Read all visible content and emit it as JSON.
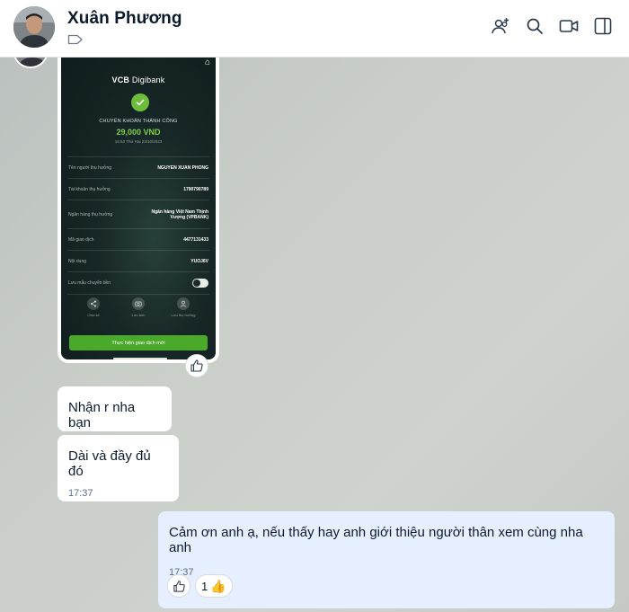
{
  "header": {
    "contact_name": "Xuân Phương"
  },
  "icons": {
    "tag": "tag-icon",
    "add_member": "add-member-icon",
    "search": "search-icon",
    "video_call": "video-call-icon",
    "panel": "sidebar-toggle-icon",
    "like": "thumbs-up-icon"
  },
  "receipt": {
    "bank_logo_bold": "VCB",
    "bank_logo_rest": "Digibank",
    "status": "CHUYỂN KHOẢN THÀNH CÔNG",
    "amount": "29,000 VND",
    "datetime": "16:53 Thứ Hai 23/10/2023",
    "rows": [
      {
        "label": "Tên người thụ hưởng",
        "value": "NGUYEN XUAN PHONG"
      },
      {
        "label": "Tài khoản thụ hưởng",
        "value": "1790790789"
      },
      {
        "label": "Ngân hàng thụ hưởng",
        "value": "Ngân hàng Việt Nam Thịnh Vượng (VPBANK)"
      },
      {
        "label": "Mã giao dịch",
        "value": "4477131433"
      },
      {
        "label": "Nội dung",
        "value": "YUOJ6V"
      }
    ],
    "save_template_label": "Lưu mẫu chuyển tiền",
    "actions": [
      "Chia sẻ",
      "Lưu ảnh",
      "Lưu thụ hưởng"
    ],
    "new_transaction_label": "Thực hiện giao dịch mới"
  },
  "messages": {
    "msg1": "Nhận r nha bạn",
    "msg2": "Dài và đầy đủ đó",
    "msg2_time": "17:37",
    "msg3": "Cảm ơn anh ạ, nếu thấy hay anh giới thiệu người thân xem cùng nha anh",
    "msg3_time": "17:37",
    "reaction_count": "1",
    "reaction_emoji": "👍"
  }
}
